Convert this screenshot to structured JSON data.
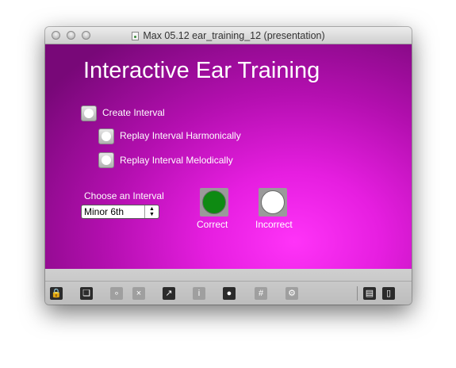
{
  "window": {
    "title": "Max 05.12 ear_training_12 (presentation)"
  },
  "patch": {
    "headline": "Interactive Ear Training",
    "create_interval": "Create Interval",
    "replay_harmonic": "Replay Interval Harmonically",
    "replay_melodic": "Replay Interval Melodically",
    "choose_label": "Choose an Interval",
    "interval_value": "Minor 6th",
    "correct_label": "Correct",
    "incorrect_label": "Incorrect"
  },
  "colors": {
    "background_accent": "#e61ee0",
    "correct_led": "#0e8a12",
    "incorrect_led": "#ffffff"
  },
  "toolbar_icons": [
    "lock-icon",
    "copy-icon",
    "patch-cords-icon",
    "delete-icon",
    "presentation-icon",
    "info-icon",
    "connect-icon",
    "grid-icon",
    "dsp-icon",
    "bottom-panel-icon",
    "side-panel-icon"
  ]
}
